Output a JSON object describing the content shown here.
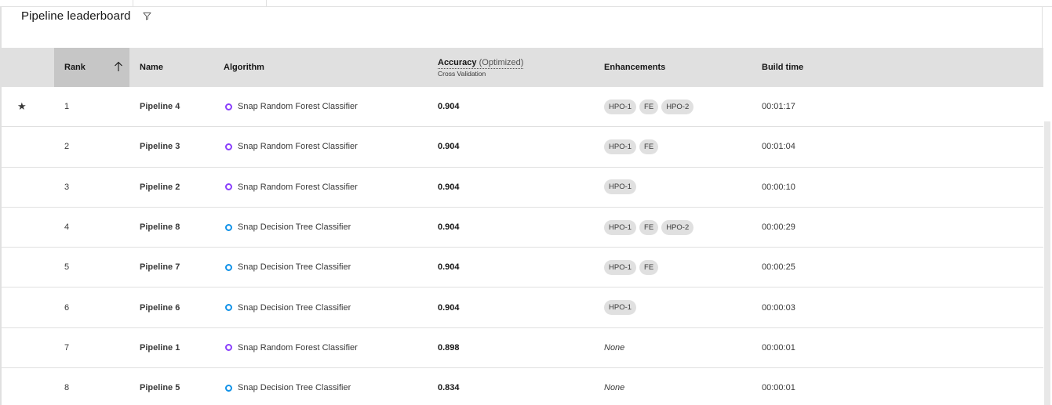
{
  "header": {
    "title": "Pipeline leaderboard",
    "filter_icon": "filter-icon"
  },
  "table": {
    "columns": {
      "rank": "Rank",
      "name": "Name",
      "algorithm": "Algorithm",
      "accuracy": "Accuracy",
      "accuracy_note": "(Optimized)",
      "accuracy_sub": "Cross Validation",
      "enhancements": "Enhancements",
      "build_time": "Build time"
    },
    "sort": {
      "column": "rank",
      "direction": "ascending"
    },
    "rows": [
      {
        "starred": true,
        "star": "★",
        "rank": "1",
        "name": "Pipeline 4",
        "algorithm": "Snap Random Forest Classifier",
        "algorithm_type": "forest",
        "accuracy": "0.904",
        "enhancements": [
          "HPO-1",
          "FE",
          "HPO-2"
        ],
        "build_time": "00:01:17"
      },
      {
        "starred": false,
        "star": "",
        "rank": "2",
        "name": "Pipeline 3",
        "algorithm": "Snap Random Forest Classifier",
        "algorithm_type": "forest",
        "accuracy": "0.904",
        "enhancements": [
          "HPO-1",
          "FE"
        ],
        "build_time": "00:01:04"
      },
      {
        "starred": false,
        "star": "",
        "rank": "3",
        "name": "Pipeline 2",
        "algorithm": "Snap Random Forest Classifier",
        "algorithm_type": "forest",
        "accuracy": "0.904",
        "enhancements": [
          "HPO-1"
        ],
        "build_time": "00:00:10"
      },
      {
        "starred": false,
        "star": "",
        "rank": "4",
        "name": "Pipeline 8",
        "algorithm": "Snap Decision Tree Classifier",
        "algorithm_type": "tree",
        "accuracy": "0.904",
        "enhancements": [
          "HPO-1",
          "FE",
          "HPO-2"
        ],
        "build_time": "00:00:29"
      },
      {
        "starred": false,
        "star": "",
        "rank": "5",
        "name": "Pipeline 7",
        "algorithm": "Snap Decision Tree Classifier",
        "algorithm_type": "tree",
        "accuracy": "0.904",
        "enhancements": [
          "HPO-1",
          "FE"
        ],
        "build_time": "00:00:25"
      },
      {
        "starred": false,
        "star": "",
        "rank": "6",
        "name": "Pipeline 6",
        "algorithm": "Snap Decision Tree Classifier",
        "algorithm_type": "tree",
        "accuracy": "0.904",
        "enhancements": [
          "HPO-1"
        ],
        "build_time": "00:00:03"
      },
      {
        "starred": false,
        "star": "",
        "rank": "7",
        "name": "Pipeline 1",
        "algorithm": "Snap Random Forest Classifier",
        "algorithm_type": "forest",
        "accuracy": "0.898",
        "enhancements": [],
        "enhancements_empty": "None",
        "build_time": "00:00:01"
      },
      {
        "starred": false,
        "star": "",
        "rank": "8",
        "name": "Pipeline 5",
        "algorithm": "Snap Decision Tree Classifier",
        "algorithm_type": "tree",
        "accuracy": "0.834",
        "enhancements": [],
        "enhancements_empty": "None",
        "build_time": "00:00:01"
      }
    ]
  },
  "colors": {
    "forest_dot": "#8a3ffc",
    "tree_dot": "#1192e8",
    "header_bg": "#e0e0e0",
    "sorted_header_bg": "#c6c6c6",
    "tag_bg": "#e0e0e0"
  }
}
